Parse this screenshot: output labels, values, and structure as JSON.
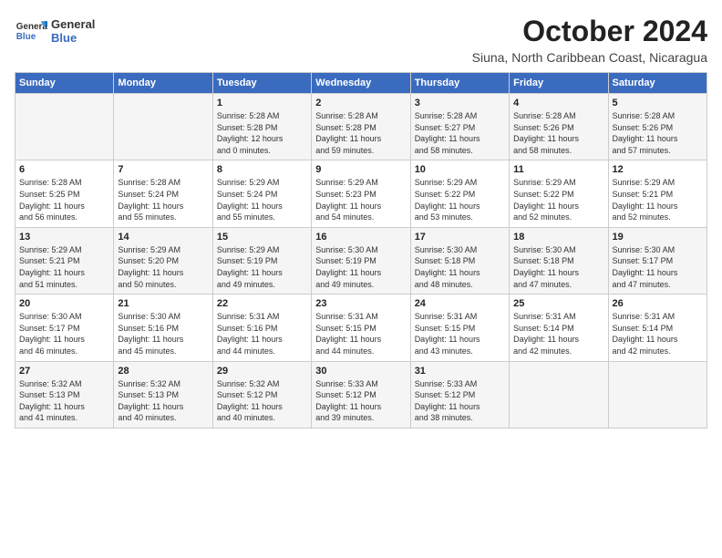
{
  "header": {
    "logo_line1": "General",
    "logo_line2": "Blue",
    "month": "October 2024",
    "location": "Siuna, North Caribbean Coast, Nicaragua"
  },
  "weekdays": [
    "Sunday",
    "Monday",
    "Tuesday",
    "Wednesday",
    "Thursday",
    "Friday",
    "Saturday"
  ],
  "weeks": [
    [
      {
        "day": "",
        "info": ""
      },
      {
        "day": "",
        "info": ""
      },
      {
        "day": "1",
        "info": "Sunrise: 5:28 AM\nSunset: 5:28 PM\nDaylight: 12 hours\nand 0 minutes."
      },
      {
        "day": "2",
        "info": "Sunrise: 5:28 AM\nSunset: 5:28 PM\nDaylight: 11 hours\nand 59 minutes."
      },
      {
        "day": "3",
        "info": "Sunrise: 5:28 AM\nSunset: 5:27 PM\nDaylight: 11 hours\nand 58 minutes."
      },
      {
        "day": "4",
        "info": "Sunrise: 5:28 AM\nSunset: 5:26 PM\nDaylight: 11 hours\nand 58 minutes."
      },
      {
        "day": "5",
        "info": "Sunrise: 5:28 AM\nSunset: 5:26 PM\nDaylight: 11 hours\nand 57 minutes."
      }
    ],
    [
      {
        "day": "6",
        "info": "Sunrise: 5:28 AM\nSunset: 5:25 PM\nDaylight: 11 hours\nand 56 minutes."
      },
      {
        "day": "7",
        "info": "Sunrise: 5:28 AM\nSunset: 5:24 PM\nDaylight: 11 hours\nand 55 minutes."
      },
      {
        "day": "8",
        "info": "Sunrise: 5:29 AM\nSunset: 5:24 PM\nDaylight: 11 hours\nand 55 minutes."
      },
      {
        "day": "9",
        "info": "Sunrise: 5:29 AM\nSunset: 5:23 PM\nDaylight: 11 hours\nand 54 minutes."
      },
      {
        "day": "10",
        "info": "Sunrise: 5:29 AM\nSunset: 5:22 PM\nDaylight: 11 hours\nand 53 minutes."
      },
      {
        "day": "11",
        "info": "Sunrise: 5:29 AM\nSunset: 5:22 PM\nDaylight: 11 hours\nand 52 minutes."
      },
      {
        "day": "12",
        "info": "Sunrise: 5:29 AM\nSunset: 5:21 PM\nDaylight: 11 hours\nand 52 minutes."
      }
    ],
    [
      {
        "day": "13",
        "info": "Sunrise: 5:29 AM\nSunset: 5:21 PM\nDaylight: 11 hours\nand 51 minutes."
      },
      {
        "day": "14",
        "info": "Sunrise: 5:29 AM\nSunset: 5:20 PM\nDaylight: 11 hours\nand 50 minutes."
      },
      {
        "day": "15",
        "info": "Sunrise: 5:29 AM\nSunset: 5:19 PM\nDaylight: 11 hours\nand 49 minutes."
      },
      {
        "day": "16",
        "info": "Sunrise: 5:30 AM\nSunset: 5:19 PM\nDaylight: 11 hours\nand 49 minutes."
      },
      {
        "day": "17",
        "info": "Sunrise: 5:30 AM\nSunset: 5:18 PM\nDaylight: 11 hours\nand 48 minutes."
      },
      {
        "day": "18",
        "info": "Sunrise: 5:30 AM\nSunset: 5:18 PM\nDaylight: 11 hours\nand 47 minutes."
      },
      {
        "day": "19",
        "info": "Sunrise: 5:30 AM\nSunset: 5:17 PM\nDaylight: 11 hours\nand 47 minutes."
      }
    ],
    [
      {
        "day": "20",
        "info": "Sunrise: 5:30 AM\nSunset: 5:17 PM\nDaylight: 11 hours\nand 46 minutes."
      },
      {
        "day": "21",
        "info": "Sunrise: 5:30 AM\nSunset: 5:16 PM\nDaylight: 11 hours\nand 45 minutes."
      },
      {
        "day": "22",
        "info": "Sunrise: 5:31 AM\nSunset: 5:16 PM\nDaylight: 11 hours\nand 44 minutes."
      },
      {
        "day": "23",
        "info": "Sunrise: 5:31 AM\nSunset: 5:15 PM\nDaylight: 11 hours\nand 44 minutes."
      },
      {
        "day": "24",
        "info": "Sunrise: 5:31 AM\nSunset: 5:15 PM\nDaylight: 11 hours\nand 43 minutes."
      },
      {
        "day": "25",
        "info": "Sunrise: 5:31 AM\nSunset: 5:14 PM\nDaylight: 11 hours\nand 42 minutes."
      },
      {
        "day": "26",
        "info": "Sunrise: 5:31 AM\nSunset: 5:14 PM\nDaylight: 11 hours\nand 42 minutes."
      }
    ],
    [
      {
        "day": "27",
        "info": "Sunrise: 5:32 AM\nSunset: 5:13 PM\nDaylight: 11 hours\nand 41 minutes."
      },
      {
        "day": "28",
        "info": "Sunrise: 5:32 AM\nSunset: 5:13 PM\nDaylight: 11 hours\nand 40 minutes."
      },
      {
        "day": "29",
        "info": "Sunrise: 5:32 AM\nSunset: 5:12 PM\nDaylight: 11 hours\nand 40 minutes."
      },
      {
        "day": "30",
        "info": "Sunrise: 5:33 AM\nSunset: 5:12 PM\nDaylight: 11 hours\nand 39 minutes."
      },
      {
        "day": "31",
        "info": "Sunrise: 5:33 AM\nSunset: 5:12 PM\nDaylight: 11 hours\nand 38 minutes."
      },
      {
        "day": "",
        "info": ""
      },
      {
        "day": "",
        "info": ""
      }
    ]
  ]
}
